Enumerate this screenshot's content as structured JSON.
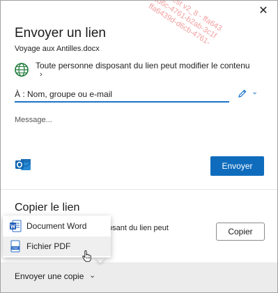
{
  "dialog": {
    "title": "Envoyer un lien",
    "filename": "Voyage aux Antilles.docx",
    "permission_text": "Toute personne disposant du lien peut modifier le contenu",
    "permission_chevron": "›",
    "to_placeholder": "À : Nom, groupe ou e-mail",
    "to_chevron": "⌄",
    "message_placeholder": "Message...",
    "send_label": "Envoyer",
    "close_label": "✕"
  },
  "copy_section": {
    "title": "Copier le lien",
    "permission_text": "isposant du lien peut",
    "permission_chevron": "›",
    "copy_label": "Copier"
  },
  "footer": {
    "send_copy_label": "Envoyer une copie",
    "send_copy_chevron": "⌄"
  },
  "dropdown": {
    "items": [
      {
        "label": "Document Word",
        "icon": "word-icon"
      },
      {
        "label": "Fichier PDF",
        "icon": "pdf-icon"
      }
    ]
  },
  "watermark": {
    "lines": [
      "4c6 test v2_8 - ffa643",
      "bd6c-4761-b2ab-3c1f",
      "ffa6439d-d6cb-4761-"
    ]
  },
  "colors": {
    "accent": "#0f6cbd",
    "underline": "#1a73c7",
    "footer_bg": "#ececec",
    "watermark": "#f2a0a0"
  }
}
